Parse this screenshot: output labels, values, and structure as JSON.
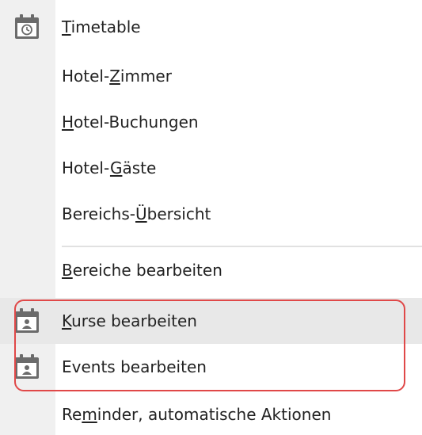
{
  "menu": {
    "items": [
      {
        "id": "timetable",
        "pre": "",
        "mnemonic": "T",
        "post": "imetable",
        "icon": "calendar-clock-icon"
      },
      {
        "id": "hotel-zimmer",
        "pre": "Hotel-",
        "mnemonic": "Z",
        "post": "immer",
        "icon": ""
      },
      {
        "id": "hotel-buchungen",
        "pre": "",
        "mnemonic": "H",
        "post": "otel-Buchungen",
        "icon": ""
      },
      {
        "id": "hotel-gaeste",
        "pre": "Hotel-",
        "mnemonic": "G",
        "post": "äste",
        "icon": ""
      },
      {
        "id": "bereichs-uebersicht",
        "pre": "Bereichs-",
        "mnemonic": "Ü",
        "post": "bersicht",
        "icon": ""
      },
      {
        "id": "bereiche-bearbeiten",
        "pre": "",
        "mnemonic": "B",
        "post": "ereiche bearbeiten",
        "icon": ""
      },
      {
        "id": "kurse-bearbeiten",
        "pre": "",
        "mnemonic": "K",
        "post": "urse bearbeiten",
        "icon": "calendar-person-icon"
      },
      {
        "id": "events-bearbeiten",
        "pre": "",
        "mnemonic": "",
        "post": "Events bearbeiten",
        "icon": "calendar-person-icon"
      },
      {
        "id": "reminder",
        "pre": "Re",
        "mnemonic": "m",
        "post": "inder, automatische Aktionen",
        "icon": ""
      }
    ]
  },
  "colors": {
    "gutter": "#f0f0f0",
    "hover": "#e8e8e8",
    "annotation": "#e04848",
    "icon": "#6b6b6b"
  }
}
